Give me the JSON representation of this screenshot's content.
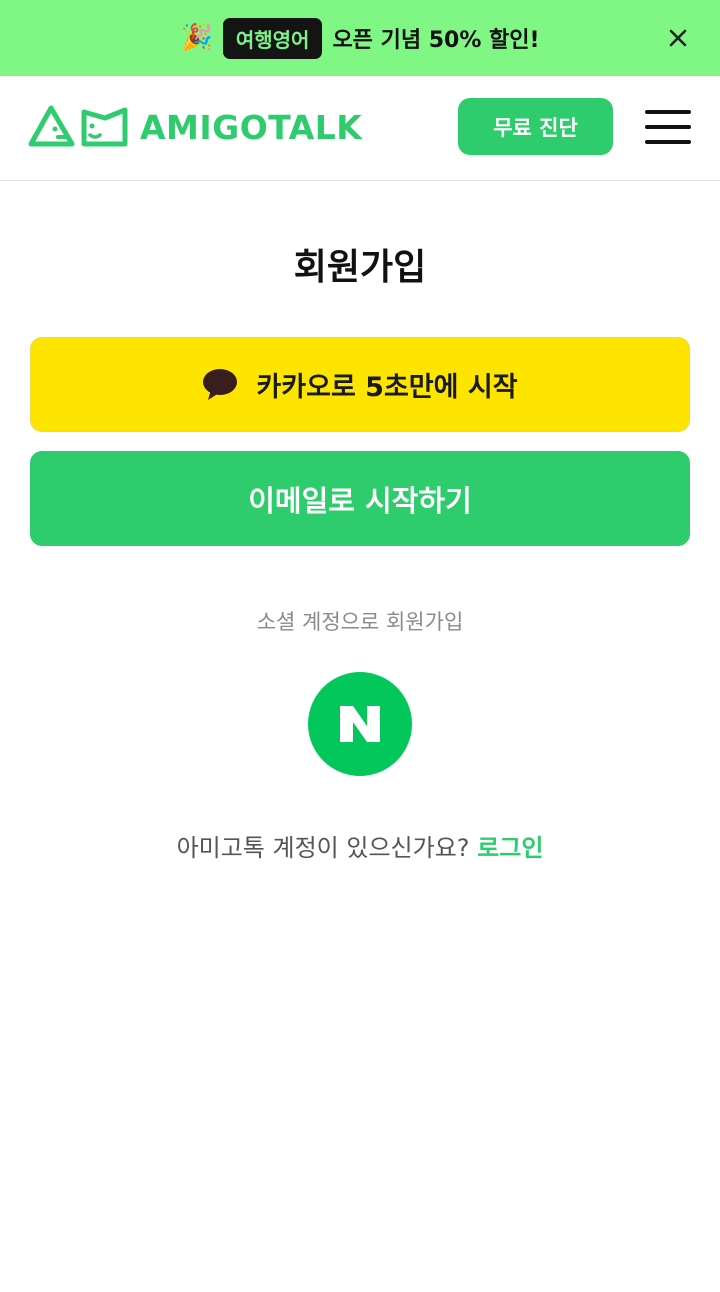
{
  "promo": {
    "emoji": "🎉",
    "badge": "여행영어",
    "text": "오픈 기념 50% 할인!",
    "close_icon": "close-icon"
  },
  "header": {
    "logo_text": "AMIGOTALK",
    "diagnosis_button": "무료 진단",
    "menu_icon": "hamburger-menu-icon"
  },
  "page": {
    "title": "회원가입",
    "kakao_button": "카카오로 5초만에 시작",
    "kakao_icon": "speech-bubble-icon",
    "email_button": "이메일로 시작하기",
    "social_label": "소셜 계정으로 회원가입",
    "naver_letter": "N",
    "login_prompt": "아미고톡 계정이 있으신가요?",
    "login_link": "로그인"
  },
  "colors": {
    "promo_bg": "#80f784",
    "brand_green": "#2ecc6c",
    "kakao_yellow": "#fee500",
    "naver_green": "#03c75a"
  }
}
